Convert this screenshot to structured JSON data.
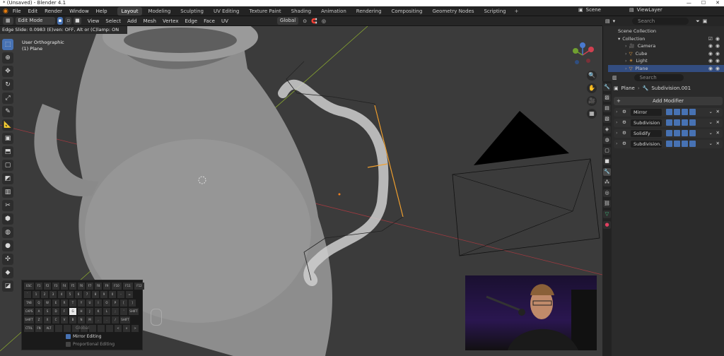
{
  "window": {
    "title": "* (Unsaved) - Blender 4.1"
  },
  "menu": {
    "items": [
      "File",
      "Edit",
      "Render",
      "Window",
      "Help"
    ],
    "workspaces": [
      "Layout",
      "Modeling",
      "Sculpting",
      "UV Editing",
      "Texture Paint",
      "Shading",
      "Animation",
      "Rendering",
      "Compositing",
      "Geometry Nodes",
      "Scripting"
    ],
    "active_workspace": "Layout",
    "add_tab": "+",
    "scene": "Scene",
    "view_layer": "ViewLayer"
  },
  "header": {
    "mode": "Edit Mode",
    "menus": [
      "View",
      "Select",
      "Add",
      "Mesh",
      "Vertex",
      "Edge",
      "Face",
      "UV"
    ],
    "orientation": "Global"
  },
  "status": {
    "text": "Edge Slide: 0.0983 (E)ven: OFF, Alt or (C)lamp: ON"
  },
  "viewport": {
    "view_name": "User Orthographic",
    "object_name": "(1) Plane"
  },
  "outliner": {
    "search_placeholder": "Search",
    "root": "Scene Collection",
    "collection": "Collection",
    "objects": [
      {
        "name": "Camera",
        "selected": false
      },
      {
        "name": "Cube",
        "selected": false
      },
      {
        "name": "Light",
        "selected": false
      },
      {
        "name": "Plane",
        "selected": true
      }
    ]
  },
  "properties": {
    "search_placeholder": "Search",
    "object": "Plane",
    "modifier_context": "Subdivision.001",
    "add_modifier": "Add Modifier",
    "modifiers": [
      "Mirror",
      "Subdivision",
      "Solidify",
      "Subdivision..."
    ]
  },
  "keyboard_overlay": {
    "rows": [
      [
        "ESC",
        "F1",
        "F2",
        "F3",
        "F4",
        "F5",
        "F6",
        "F7",
        "F8",
        "F9",
        "F10",
        "F11",
        "F12"
      ],
      [
        "`",
        "1",
        "2",
        "3",
        "4",
        "5",
        "6",
        "7",
        "8",
        "9",
        "0",
        "-",
        "="
      ],
      [
        "TAB",
        "Q",
        "W",
        "E",
        "R",
        "T",
        "Y",
        "U",
        "I",
        "O",
        "P",
        "[",
        "]"
      ],
      [
        "CAPS",
        "A",
        "S",
        "D",
        "F",
        "G",
        "H",
        "J",
        "K",
        "L",
        ";",
        "'",
        "SHIFT"
      ],
      [
        "SHIFT",
        "Z",
        "X",
        "C",
        "V",
        "B",
        "N",
        "M",
        ",",
        ".",
        "/",
        "SHIFT"
      ],
      [
        "CTRL",
        "FN",
        "ALT",
        "",
        "",
        "",
        "",
        "",
        "",
        "",
        "<",
        "v",
        ">"
      ]
    ],
    "highlighted": [
      "G"
    ],
    "global_label": "Global",
    "mirror_editing": "Mirror Editing",
    "proportional_editing": "Proportional Editing"
  },
  "colors": {
    "accent": "#4772b3",
    "selected_row": "#334d80",
    "edge_highlight": "#f0a030"
  }
}
